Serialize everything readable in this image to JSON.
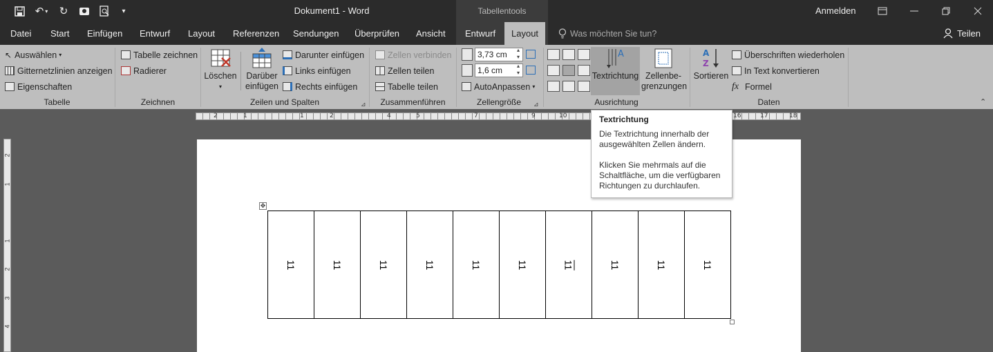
{
  "titlebar": {
    "doc_title": "Dokument1  -  Word",
    "context_title": "Tabellentools",
    "signin": "Anmelden"
  },
  "tabs": [
    "Datei",
    "Start",
    "Einfügen",
    "Entwurf",
    "Layout",
    "Referenzen",
    "Sendungen",
    "Überprüfen",
    "Ansicht"
  ],
  "context_tabs": {
    "design": "Entwurf",
    "layout": "Layout"
  },
  "tellme": "Was möchten Sie tun?",
  "share": "Teilen",
  "ribbon": {
    "tabelle": {
      "label": "Tabelle",
      "select": "Auswählen",
      "gridlines": "Gitternetzlinien anzeigen",
      "properties": "Eigenschaften"
    },
    "zeichnen": {
      "label": "Zeichnen",
      "draw": "Tabelle zeichnen",
      "eraser": "Radierer"
    },
    "zeilen": {
      "label": "Zeilen und Spalten",
      "delete": "Löschen",
      "above_1": "Darüber",
      "above_2": "einfügen",
      "below": "Darunter einfügen",
      "left": "Links einfügen",
      "right": "Rechts einfügen"
    },
    "zusammen": {
      "label": "Zusammenführen",
      "merge": "Zellen verbinden",
      "split_cells": "Zellen teilen",
      "split_table": "Tabelle teilen"
    },
    "groesse": {
      "label": "Zellengröße",
      "height": "3,73 cm",
      "width": "1,6 cm",
      "autofit": "AutoAnpassen"
    },
    "ausrichtung": {
      "label": "Ausrichtung",
      "direction": "Textrichtung",
      "margins_1": "Zellenbe-",
      "margins_2": "grenzungen"
    },
    "daten": {
      "label": "Daten",
      "sort": "Sortieren",
      "repeat": "Überschriften wiederholen",
      "convert": "In Text konvertieren",
      "formula": "Formel"
    }
  },
  "tooltip": {
    "title": "Textrichtung",
    "line1": "Die Textrichtung innerhalb der ausgewählten Zellen ändern.",
    "line2": "Klicken Sie mehrmals auf die Schaltfläche, um die verfügbaren Richtungen zu durchlaufen."
  },
  "ruler_h": [
    "2",
    "1",
    "1",
    "2",
    "4",
    "5",
    "7",
    "9",
    "10",
    "16",
    "17",
    "18"
  ],
  "ruler_v": [
    "2",
    "1",
    "1",
    "2",
    "3",
    "4"
  ],
  "table_cells": [
    "11",
    "11",
    "11",
    "11",
    "11",
    "11",
    "11",
    "11",
    "11",
    "11"
  ]
}
